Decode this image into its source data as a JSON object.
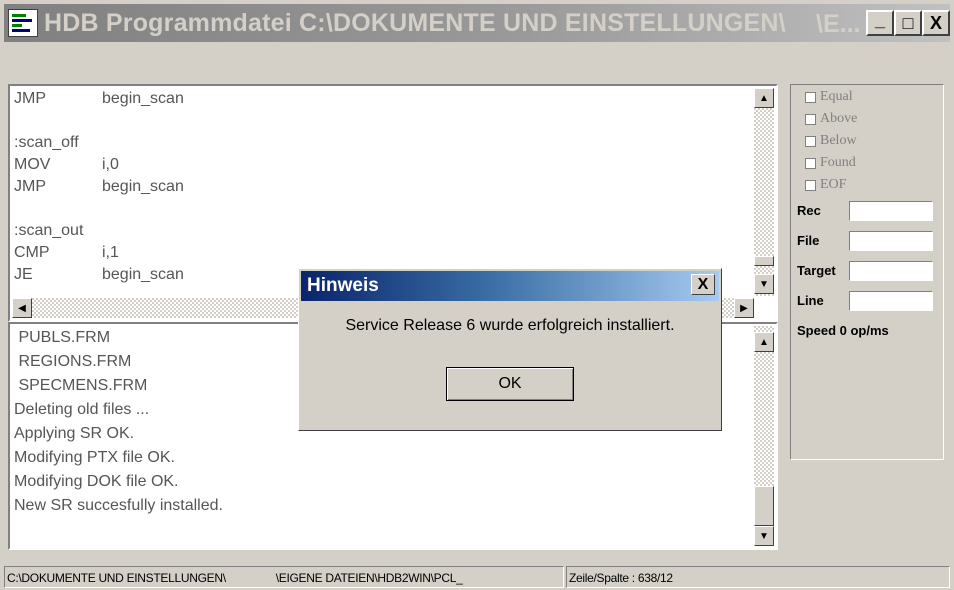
{
  "window": {
    "title": "HDB Programmdatei C:\\DOKUMENTE UND EINSTELLUNGEN\\",
    "title_tail": "\\E...",
    "buttons": {
      "minimize": "_",
      "maximize": "□",
      "close": "X"
    }
  },
  "code_lines": [
    {
      "op": "JMP",
      "arg": "begin_scan"
    },
    {
      "op": "",
      "arg": ""
    },
    {
      "op": ":scan_off",
      "arg": ""
    },
    {
      "op": "MOV",
      "arg": "i,0"
    },
    {
      "op": "JMP",
      "arg": "begin_scan"
    },
    {
      "op": "",
      "arg": ""
    },
    {
      "op": ":scan_out",
      "arg": ""
    },
    {
      "op": "CMP",
      "arg": "i,1"
    },
    {
      "op": "JE",
      "arg": "begin_scan"
    }
  ],
  "log_lines": [
    " PUBLS.FRM",
    " REGIONS.FRM",
    " SPECMENS.FRM",
    "Deleting old files ...",
    "Applying SR OK.",
    "Modifying PTX file OK.",
    "Modifying DOK file OK.",
    "New SR succesfully installed."
  ],
  "flags": [
    "Equal",
    "Above",
    "Below",
    "Found",
    "EOF"
  ],
  "fields": {
    "rec": "Rec",
    "file": "File",
    "target": "Target",
    "line": "Line",
    "speed": "Speed 0 op/ms"
  },
  "dialog": {
    "title": "Hinweis",
    "message": "Service Release 6 wurde erfolgreich installiert.",
    "ok": "OK",
    "close": "X"
  },
  "status": {
    "path1": "C:\\DOKUMENTE UND EINSTELLUNGEN\\",
    "path2": "\\EIGENE DATEIEN\\HDB2WIN\\PCL_",
    "position": "Zeile/Spalte : 638/12"
  },
  "scroll_arrows": {
    "up": "▲",
    "down": "▼",
    "left": "◀",
    "right": "▶"
  }
}
